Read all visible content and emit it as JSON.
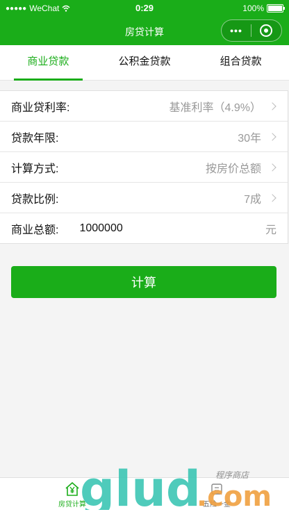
{
  "status_bar": {
    "signal": "●●●●●",
    "carrier": "WeChat",
    "time": "0:29",
    "battery": "100%"
  },
  "nav": {
    "title": "房贷计算",
    "more_glyph": "•••"
  },
  "tabs": [
    {
      "label": "商业贷款",
      "active": true
    },
    {
      "label": "公积金贷款",
      "active": false
    },
    {
      "label": "组合贷款",
      "active": false
    }
  ],
  "form": {
    "rate": {
      "label": "商业贷利率:",
      "value": "基准利率（4.9%）"
    },
    "term": {
      "label": "贷款年限:",
      "value": "30年"
    },
    "method": {
      "label": "计算方式:",
      "value": "按房价总额"
    },
    "ratio": {
      "label": "贷款比例:",
      "value": "7成"
    },
    "total": {
      "label": "商业总额:",
      "value": "1000000",
      "unit": "元"
    }
  },
  "calc_button": "计算",
  "tabbar": [
    {
      "label": "房贷计算",
      "icon": "house-yuan-icon",
      "active": true
    },
    {
      "label": "五险一金",
      "icon": "insurance-icon",
      "active": false
    }
  ],
  "watermark": {
    "brand": "glud",
    "suffix": ".com",
    "tagline": "程序商店"
  },
  "colors": {
    "accent": "#1aad19"
  }
}
